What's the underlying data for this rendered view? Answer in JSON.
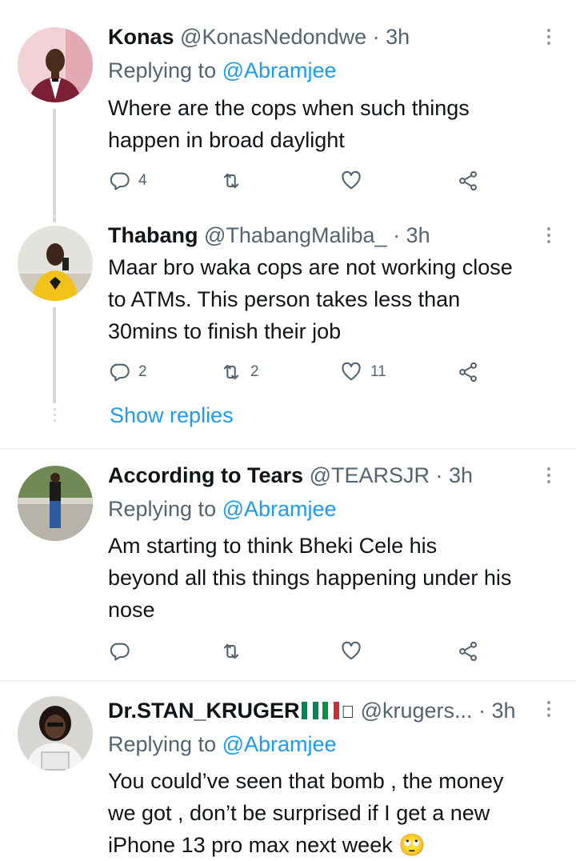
{
  "tweets": [
    {
      "name": "Konas",
      "handle": "@KonasNedondwe · 3h",
      "replying_prefix": "Replying to ",
      "replying_to": "@Abramjee",
      "text_lines": [
        "Where are the cops when such things",
        "happen in broad daylight"
      ],
      "replies": "4",
      "retweets": "",
      "likes": ""
    },
    {
      "name": "Thabang",
      "handle": "@ThabangMaliba_ · 3h",
      "text_lines": [
        "Maar bro waka cops are not working close",
        "to ATMs. This person takes less than",
        "30mins to finish their job"
      ],
      "replies": "2",
      "retweets": "2",
      "likes": "11",
      "show_replies": "Show replies"
    },
    {
      "name": "According to Tears",
      "handle": "@TEARSJR · 3h",
      "replying_prefix": "Replying to ",
      "replying_to": "@Abramjee",
      "text_lines": [
        "Am starting to think Bheki Cele his",
        "beyond all this things happening under his",
        "nose"
      ],
      "replies": "",
      "retweets": "",
      "likes": ""
    },
    {
      "name": "Dr.STAN_KRUGER",
      "name_suffix": "",
      "handle": "@krugers... · 3h",
      "replying_prefix": "Replying to ",
      "replying_to": "@Abramjee",
      "text_lines": [
        "You could’ve seen that bomb , the money",
        "we got , don’t be surprised if I get a new",
        "iPhone 13 pro max next week"
      ],
      "emoji": "🙄"
    }
  ],
  "icons": {
    "reply": "reply-icon",
    "retweet": "retweet-icon",
    "like": "heart-icon",
    "share": "share-icon",
    "more": "more-icon"
  },
  "colors": {
    "link": "#1d9bf0",
    "muted": "#536471",
    "text": "#0f1419",
    "thread": "#cfd9de"
  }
}
